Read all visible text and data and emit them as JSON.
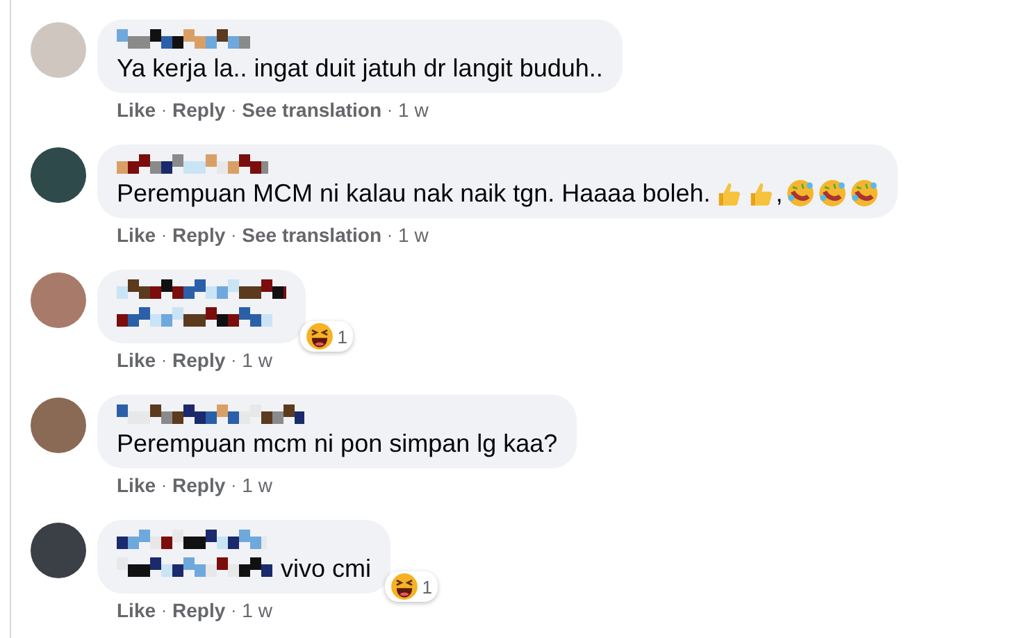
{
  "separator": "·",
  "comments": [
    {
      "body": [
        {
          "kind": "text",
          "text": "Ya kerja la.. ingat duit jatuh dr langit buduh.."
        }
      ],
      "actions": [
        {
          "kind": "link",
          "text": "Like"
        },
        {
          "kind": "link",
          "text": "Reply"
        },
        {
          "kind": "link",
          "text": "See translation"
        },
        {
          "kind": "time",
          "text": "1 w"
        }
      ]
    },
    {
      "body": [
        {
          "kind": "text",
          "text": "Perempuan MCM ni kalau nak naik tgn. Haaaa boleh."
        },
        {
          "kind": "thumbs_up"
        },
        {
          "kind": "thumbs_up"
        },
        {
          "kind": "text",
          "text": ","
        },
        {
          "kind": "rofl"
        },
        {
          "kind": "rofl"
        },
        {
          "kind": "rofl"
        }
      ],
      "actions": [
        {
          "kind": "link",
          "text": "Like"
        },
        {
          "kind": "link",
          "text": "Reply"
        },
        {
          "kind": "link",
          "text": "See translation"
        },
        {
          "kind": "time",
          "text": "1 w"
        }
      ]
    },
    {
      "body": [
        {
          "kind": "redacted"
        }
      ],
      "reaction": {
        "count": "1"
      },
      "actions": [
        {
          "kind": "link",
          "text": "Like"
        },
        {
          "kind": "link",
          "text": "Reply"
        },
        {
          "kind": "time",
          "text": "1 w"
        }
      ]
    },
    {
      "body": [
        {
          "kind": "text",
          "text": "Perempuan mcm ni pon simpan lg kaa?"
        }
      ],
      "actions": [
        {
          "kind": "link",
          "text": "Like"
        },
        {
          "kind": "link",
          "text": "Reply"
        },
        {
          "kind": "time",
          "text": "1 w"
        }
      ]
    },
    {
      "body": [
        {
          "kind": "redacted"
        },
        {
          "kind": "text",
          "text": " vivo cmi"
        }
      ],
      "reaction": {
        "count": "1"
      },
      "actions": [
        {
          "kind": "link",
          "text": "Like"
        },
        {
          "kind": "link",
          "text": "Reply"
        },
        {
          "kind": "time",
          "text": "1 w"
        }
      ]
    }
  ]
}
